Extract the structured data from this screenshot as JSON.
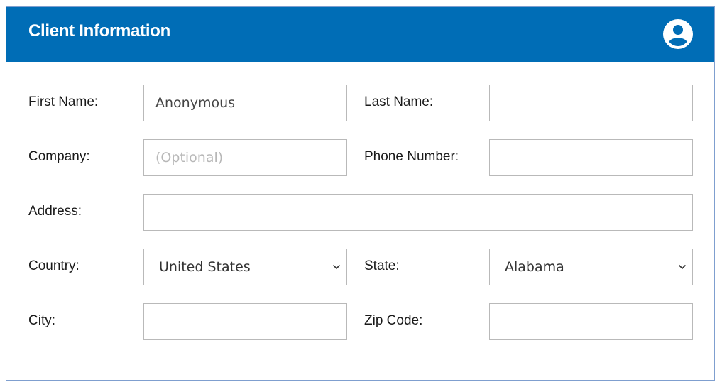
{
  "panel": {
    "title": "Client Information",
    "header_color": "#006db6",
    "icon": "user-circle-icon"
  },
  "form": {
    "first_name": {
      "label": "First Name:",
      "value": "Anonymous",
      "placeholder": ""
    },
    "last_name": {
      "label": "Last Name:",
      "value": "",
      "placeholder": ""
    },
    "company": {
      "label": "Company:",
      "value": "",
      "placeholder": "(Optional)"
    },
    "phone": {
      "label": "Phone Number:",
      "value": "",
      "placeholder": ""
    },
    "address": {
      "label": "Address:",
      "value": "",
      "placeholder": ""
    },
    "country": {
      "label": "Country:",
      "selected": "United States"
    },
    "state": {
      "label": "State:",
      "selected": "Alabama"
    },
    "city": {
      "label": "City:",
      "value": "",
      "placeholder": ""
    },
    "zip": {
      "label": "Zip Code:",
      "value": "",
      "placeholder": ""
    }
  }
}
